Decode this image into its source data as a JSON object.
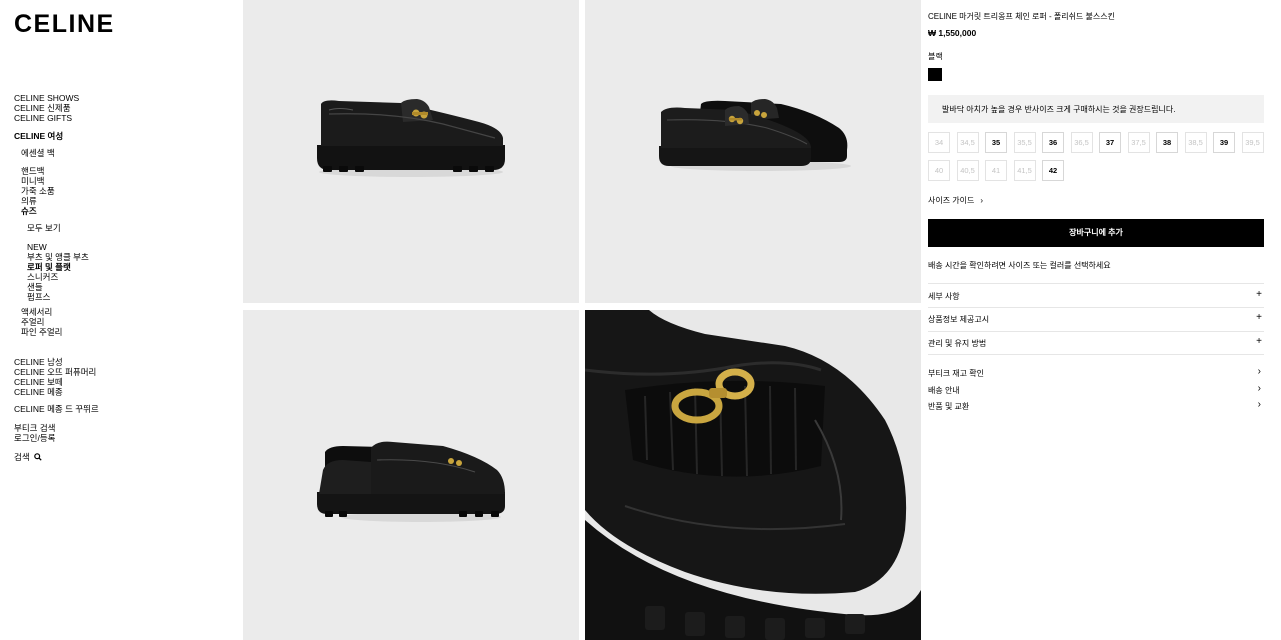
{
  "brand": {
    "logo": "CELINE"
  },
  "sidebar": {
    "group1": [
      "CELINE SHOWS",
      "CELINE 신제품",
      "CELINE GIFTS"
    ],
    "women_title": "CELINE 여성",
    "essential": "에센셜 백",
    "categories": [
      "핸드백",
      "미니백",
      "가죽 소품",
      "의류"
    ],
    "shoes": "슈즈",
    "view_all": "모두 보기",
    "shoe_items": [
      "NEW",
      "부츠 및 앵클 부츠",
      "로퍼 및 플랫",
      "스니커즈",
      "샌들",
      "펌프스"
    ],
    "others": [
      "액세서리",
      "주얼리",
      "파인 주얼리"
    ],
    "group3": [
      "CELINE 남성",
      "CELINE 오뜨 퍼퓨머리",
      "CELINE 보떼",
      "CELINE 메종"
    ],
    "maison": "CELINE 메종 드 꾸뛰르",
    "group4": [
      "부티크 검색",
      "로그인/등록"
    ],
    "search": "검색"
  },
  "product": {
    "title": "CELINE 마거릿 트리옹프 체인 로퍼 - 폴리쉬드 불스스킨",
    "price": "₩ 1,550,000",
    "color_label": "블랙",
    "color_hex": "#000000",
    "fit_note": "발바닥 아치가 높을 경우 반사이즈 크게 구매하시는 것을 권장드립니다.",
    "sizes": [
      {
        "label": "34",
        "available": false
      },
      {
        "label": "34,5",
        "available": false
      },
      {
        "label": "35",
        "available": true
      },
      {
        "label": "35,5",
        "available": false
      },
      {
        "label": "36",
        "available": true
      },
      {
        "label": "36,5",
        "available": false
      },
      {
        "label": "37",
        "available": true
      },
      {
        "label": "37,5",
        "available": false
      },
      {
        "label": "38",
        "available": true
      },
      {
        "label": "38,5",
        "available": false
      },
      {
        "label": "39",
        "available": true
      },
      {
        "label": "39,5",
        "available": false
      },
      {
        "label": "40",
        "available": false
      },
      {
        "label": "40,5",
        "available": false
      },
      {
        "label": "41",
        "available": false
      },
      {
        "label": "41,5",
        "available": false
      },
      {
        "label": "42",
        "available": true
      }
    ],
    "size_guide": "사이즈 가이드",
    "add_to_cart": "장바구니에 추가",
    "shipping_note": "배송 시간을 확인하려면 사이즈 또는 컬러를 선택하세요",
    "accordions": [
      "세부 사항",
      "상품정보 제공고시",
      "관리 및 유지 방법"
    ],
    "links": [
      "부티크 재고 확인",
      "배송 안내",
      "반품 및 교환"
    ]
  }
}
